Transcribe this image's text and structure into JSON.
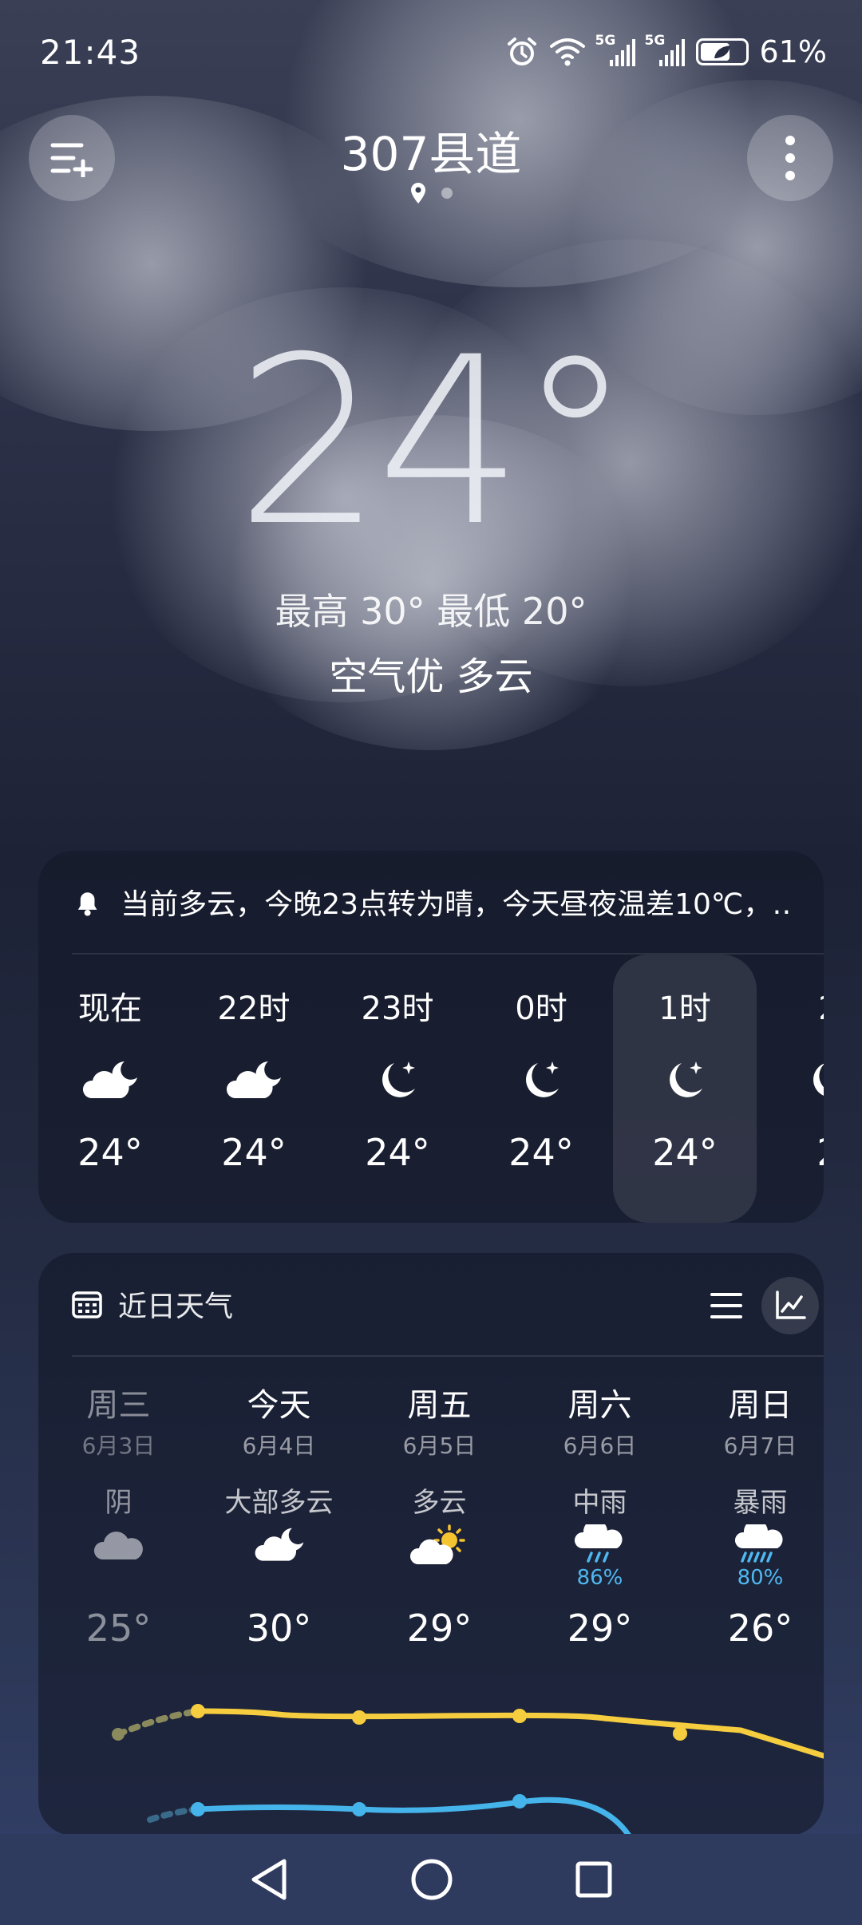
{
  "status_bar": {
    "time": "21:43",
    "icons": [
      "alarm-icon",
      "wifi-icon",
      "signal-5g-icon",
      "signal-5g-icon",
      "battery-saver-icon"
    ],
    "network_label": "5G",
    "battery": "61%"
  },
  "header": {
    "location": "307县道",
    "menu_icon": "city-list-add-icon",
    "more_icon": "more-vertical-icon"
  },
  "current": {
    "temperature": "24°",
    "hi_lo": "最高 30° 最低 20°",
    "air_and_condition": "空气优  多云"
  },
  "alert": {
    "icon": "bell-icon",
    "text": "当前多云，今晚23点转为晴，今天昼夜温差10℃，…"
  },
  "hourly": [
    {
      "label": "现在",
      "icon": "cloudy-night-icon",
      "temp": "24°"
    },
    {
      "label": "22时",
      "icon": "cloudy-night-icon",
      "temp": "24°"
    },
    {
      "label": "23时",
      "icon": "clear-night-icon",
      "temp": "24°"
    },
    {
      "label": "0时",
      "icon": "clear-night-icon",
      "temp": "24°"
    },
    {
      "label": "1时",
      "icon": "clear-night-icon",
      "temp": "24°",
      "selected": true
    },
    {
      "label": "2",
      "icon": "clear-night-icon",
      "temp": "2"
    }
  ],
  "daily": {
    "title": "近日天气",
    "icon": "calendar-icon",
    "view_list_icon": "list-view-icon",
    "view_chart_icon": "chart-view-icon",
    "days": [
      {
        "name": "周三",
        "date": "6月3日",
        "condition": "阴",
        "icon": "overcast-icon",
        "pop": "",
        "high": "25°"
      },
      {
        "name": "今天",
        "date": "6月4日",
        "condition": "大部多云",
        "icon": "cloudy-night-icon",
        "pop": "",
        "high": "30°"
      },
      {
        "name": "周五",
        "date": "6月5日",
        "condition": "多云",
        "icon": "partly-cloudy-day-icon",
        "pop": "",
        "high": "29°"
      },
      {
        "name": "周六",
        "date": "6月6日",
        "condition": "中雨",
        "icon": "rain-icon",
        "pop": "86%",
        "high": "29°"
      },
      {
        "name": "周日",
        "date": "6月7日",
        "condition": "暴雨",
        "icon": "heavy-rain-icon",
        "pop": "80%",
        "high": "26°"
      }
    ],
    "trend_colors": {
      "high": "#f5cd3f",
      "low": "#45b4ea"
    }
  },
  "nav_bar": {
    "back_icon": "back-triangle-icon",
    "home_icon": "home-circle-icon",
    "recents_icon": "recents-square-icon"
  }
}
